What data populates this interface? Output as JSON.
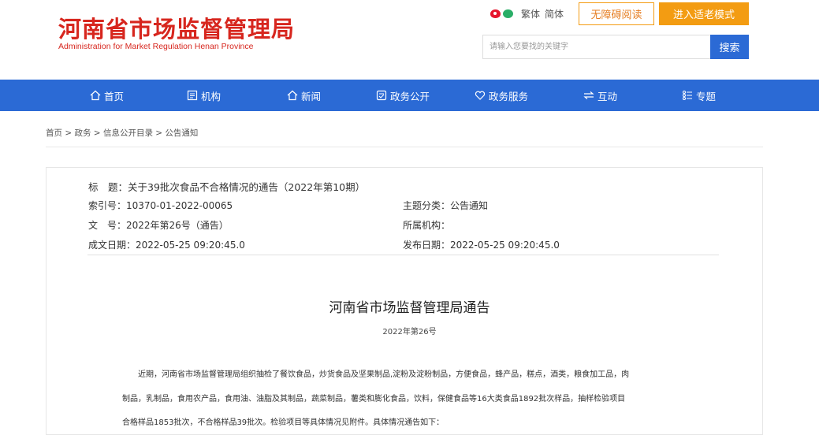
{
  "header": {
    "logo_cn": "河南省市场监督管理局",
    "logo_en": "Administration for Market Regulation Henan Province",
    "lang_traditional": "繁体",
    "lang_simplified": "简体",
    "accessibility_btn": "无障碍阅读",
    "elder_mode_btn": "进入适老模式",
    "search_placeholder": "请输入您要找的关键字",
    "search_btn": "搜索"
  },
  "nav": {
    "items": [
      {
        "label": "首页",
        "icon": "home-icon"
      },
      {
        "label": "机构",
        "icon": "org-icon"
      },
      {
        "label": "新闻",
        "icon": "news-icon"
      },
      {
        "label": "政务公开",
        "icon": "open-gov-icon"
      },
      {
        "label": "政务服务",
        "icon": "heart-icon"
      },
      {
        "label": "互动",
        "icon": "exchange-icon"
      },
      {
        "label": "专题",
        "icon": "topic-icon"
      }
    ]
  },
  "breadcrumb": "首页 > 政务 > 信息公开目录 > 公告通知",
  "meta": {
    "title": "标　题：关于39批次食品不合格情况的通告（2022年第10期）",
    "index": "索引号：10370-01-2022-00065",
    "category": "主题分类：公告通知",
    "doc_no": "文　号：2022年第26号（通告）",
    "org": "所属机构：",
    "created": "成文日期：2022-05-25 09:20:45.0",
    "published": "发布日期：2022-05-25 09:20:45.0"
  },
  "article": {
    "heading": "河南省市场监督管理局通告",
    "number": "2022年第26号",
    "para1": "近期，河南省市场监督管理局组织抽检了餐饮食品，炒货食品及坚果制品,淀粉及淀粉制品，方便食品，蜂产品，糕点，酒类，粮食加工品，肉",
    "para2": "制品，乳制品，食用农产品，食用油、油脂及其制品，蔬菜制品，薯类和膨化食品，饮料，保健食品等16大类食品1892批次样品，抽样检验项目",
    "para3": "合格样品1853批次，不合格样品39批次。检验项目等具体情况见附件。具体情况通告如下："
  },
  "colors": {
    "brand_red": "#d7261e",
    "nav_blue": "#2b6ad5",
    "accent_orange": "#f39c12"
  }
}
